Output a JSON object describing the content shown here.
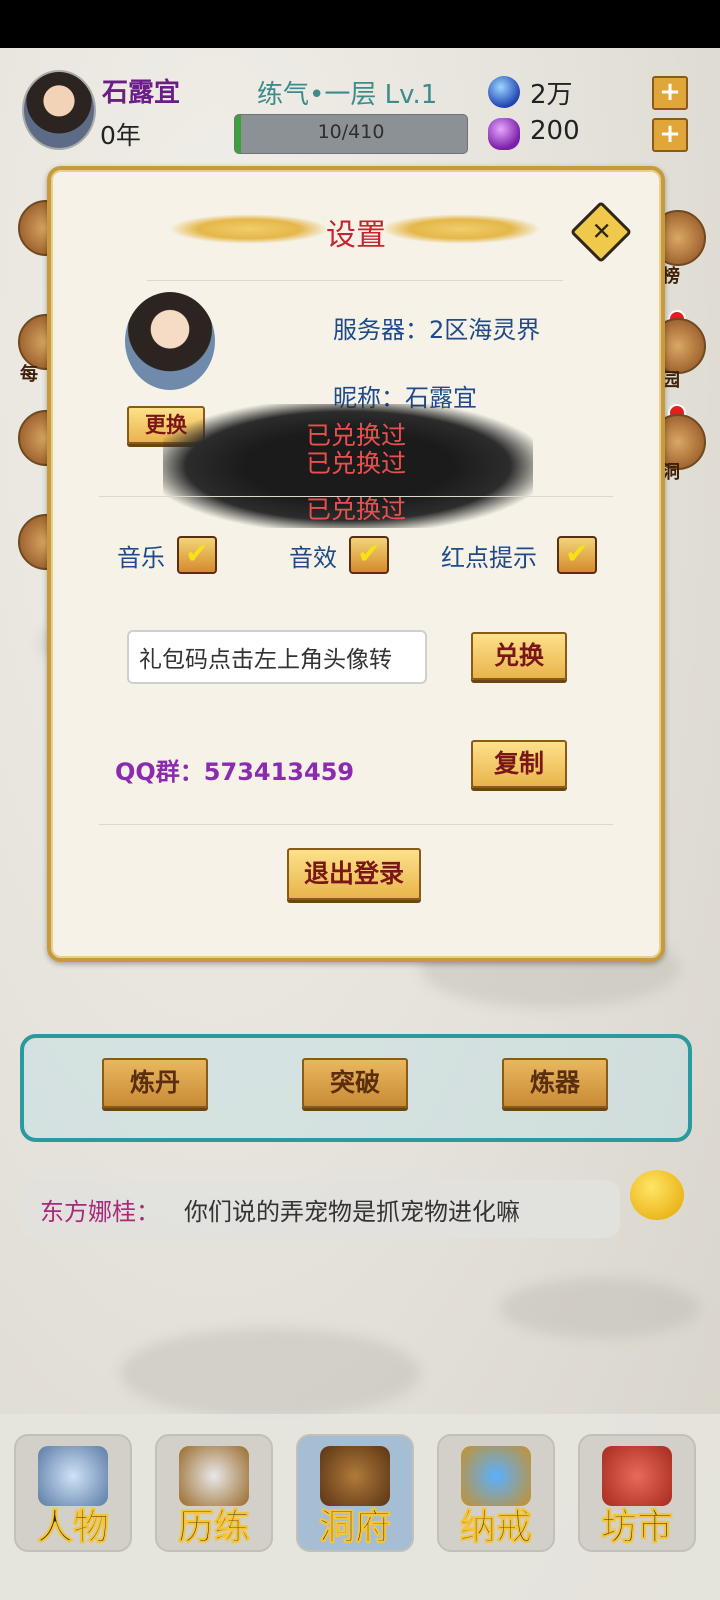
{
  "player": {
    "name": "石露宜",
    "age": "0年",
    "realm": "练气•一层 Lv.1",
    "exp": "10/410",
    "exp_ratio": 0.024,
    "spirit_stones": "2万",
    "purple_gems": "200",
    "plus": "+"
  },
  "side_labels": {
    "left_daily": "每",
    "right_rank": "榜",
    "right_garden": "园",
    "right_cave": "洞"
  },
  "settings": {
    "title": "设置",
    "close_glyph": "✕",
    "change_button": "更换",
    "server": "服务器：2区海灵界",
    "nickname": "昵称：石露宜",
    "redeemed_lines": [
      "已兑换过",
      "已兑换过",
      "已兑换过"
    ],
    "music_label": "音乐",
    "sound_label": "音效",
    "reddot_label": "红点提示",
    "check_glyph": "✔",
    "gift_code_value": "礼包码点击左上角头像转",
    "redeem_button": "兑换",
    "qq_group": "QQ群：573413459",
    "copy_button": "复制",
    "logout_button": "退出登录"
  },
  "actions": {
    "alchemy": "炼丹",
    "breakthrough": "突破",
    "forging": "炼器"
  },
  "chat": {
    "sender": "东方娜桂：",
    "message": "你们说的弄宠物是抓宠物进化嘛"
  },
  "nav": {
    "character": "人物",
    "training": "历练",
    "cave": "洞府",
    "ring": "纳戒",
    "market": "坊市"
  },
  "colors": {
    "dialog_border": "#c79a3b",
    "title_red": "#c2262e",
    "info_blue": "#1e4a8a",
    "qq_purple": "#8a2bb0",
    "panel_teal": "#2a9aa0"
  }
}
